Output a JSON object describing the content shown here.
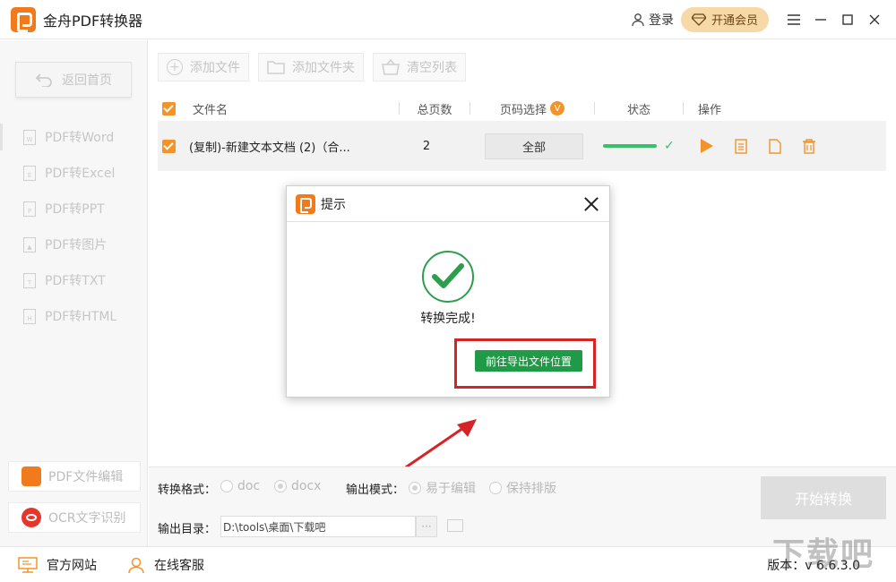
{
  "app": {
    "title": "金舟PDF转换器",
    "login_label": "登录",
    "vip_label": "开通会员"
  },
  "sidebar": {
    "home_label": "返回首页",
    "items": [
      {
        "label": "PDF转Word",
        "icon_text": "W"
      },
      {
        "label": "PDF转Excel",
        "icon_text": "E"
      },
      {
        "label": "PDF转PPT",
        "icon_text": "P"
      },
      {
        "label": "PDF转图片",
        "icon_text": "▲"
      },
      {
        "label": "PDF转TXT",
        "icon_text": "T"
      },
      {
        "label": "PDF转HTML",
        "icon_text": "H"
      }
    ],
    "tools": [
      {
        "label": "PDF文件编辑"
      },
      {
        "label": "OCR文字识别"
      }
    ]
  },
  "toolbar": {
    "add_file": "添加文件",
    "add_folder": "添加文件夹",
    "clear_list": "清空列表"
  },
  "table": {
    "headers": {
      "filename": "文件名",
      "pages": "总页数",
      "page_select": "页码选择",
      "page_select_badge": "V",
      "status": "状态",
      "actions": "操作"
    },
    "rows": [
      {
        "filename": "(复制)-新建文本文档 (2)（合...",
        "pages": "2",
        "page_select": "全部",
        "progress": 1.0
      }
    ]
  },
  "dialog": {
    "title": "提示",
    "message": "转换完成!",
    "button": "前往导出文件位置"
  },
  "bottom": {
    "format_label": "转换格式：",
    "format_options": [
      "doc",
      "docx"
    ],
    "format_selected": "docx",
    "mode_label": "输出模式：",
    "mode_options": [
      "易于编辑",
      "保持排版"
    ],
    "mode_selected": "易于编辑",
    "output_label": "输出目录：",
    "output_path": "D:\\tools\\桌面\\下载吧",
    "browse_label": "···",
    "start_label": "开始转换"
  },
  "statusbar": {
    "website": "官方网站",
    "support": "在线客服",
    "version": "版本：v 6.6.3.0"
  },
  "watermark": "下载吧",
  "colors": {
    "accent": "#f07a1c",
    "success": "#1f9a46",
    "highlight": "#d62426"
  }
}
